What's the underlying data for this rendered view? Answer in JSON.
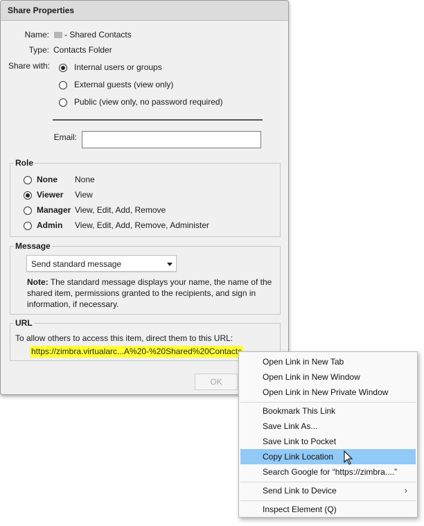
{
  "dialog": {
    "title": "Share Properties",
    "name_label": "Name:",
    "name_value": "- Shared Contacts",
    "type_label": "Type:",
    "type_value": "Contacts Folder",
    "share_with_label": "Share with:",
    "share_options": [
      {
        "label": "Internal users or groups",
        "selected": true
      },
      {
        "label": "External guests (view only)",
        "selected": false
      },
      {
        "label": "Public (view only, no password required)",
        "selected": false
      }
    ],
    "email_label": "Email:",
    "email_value": "",
    "role": {
      "legend": "Role",
      "options": [
        {
          "name": "None",
          "desc": "None",
          "selected": false
        },
        {
          "name": "Viewer",
          "desc": "View",
          "selected": true
        },
        {
          "name": "Manager",
          "desc": "View, Edit, Add, Remove",
          "selected": false
        },
        {
          "name": "Admin",
          "desc": "View, Edit, Add, Remove, Administer",
          "selected": false
        }
      ]
    },
    "message": {
      "legend": "Message",
      "select_value": "Send standard message",
      "note_bold": "Note:",
      "note_line1": " The standard message displays your name, the name of the",
      "note_line2": "shared item, permissions granted to the recipients, and sign in",
      "note_line3": "information, if necessary."
    },
    "url": {
      "legend": "URL",
      "instruction": "To allow others to access this item, direct them to this URL:",
      "link": "https://zimbra.virtualarc...A%20-%20Shared%20Contacts"
    },
    "ok_label": "OK"
  },
  "context_menu": {
    "items": [
      {
        "label": "Open Link in New Tab"
      },
      {
        "label": "Open Link in New Window"
      },
      {
        "label": "Open Link in New Private Window"
      },
      {
        "label": "Bookmark This Link"
      },
      {
        "label": "Save Link As..."
      },
      {
        "label": "Save Link to Pocket"
      },
      {
        "label": "Copy Link Location",
        "highlighted": true
      },
      {
        "label": "Search Google for “https://zimbra....”"
      },
      {
        "label": "Send Link to Device",
        "submenu": true
      },
      {
        "label": "Inspect Element (Q)"
      }
    ]
  },
  "colors": {
    "url_highlight": "#ffff33",
    "menu_highlight": "#91c9f7"
  }
}
